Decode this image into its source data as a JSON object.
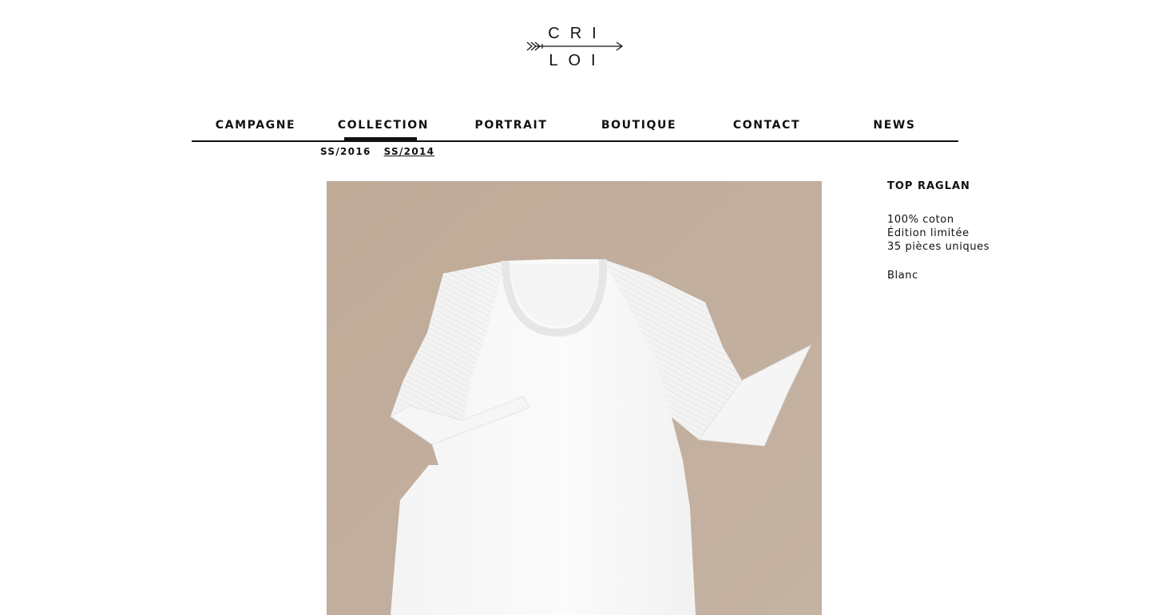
{
  "logo": {
    "line1": "CRI",
    "line2": "LOI"
  },
  "nav": {
    "items": [
      {
        "label": "CAMPAGNE",
        "active": false
      },
      {
        "label": "COLLECTION",
        "active": true
      },
      {
        "label": "PORTRAIT",
        "active": false
      },
      {
        "label": "BOUTIQUE",
        "active": false
      },
      {
        "label": "CONTACT",
        "active": false
      },
      {
        "label": "NEWS",
        "active": false
      }
    ]
  },
  "subnav": {
    "items": [
      {
        "label": "SS/2016",
        "active": false
      },
      {
        "label": "SS/2014",
        "active": true
      }
    ]
  },
  "product": {
    "title": "TOP RAGLAN",
    "material": "100% coton",
    "edition": "Édition limitée",
    "pieces": "35 pièces uniques",
    "color_name": "Blanc",
    "background_color": "#bfab9a"
  }
}
